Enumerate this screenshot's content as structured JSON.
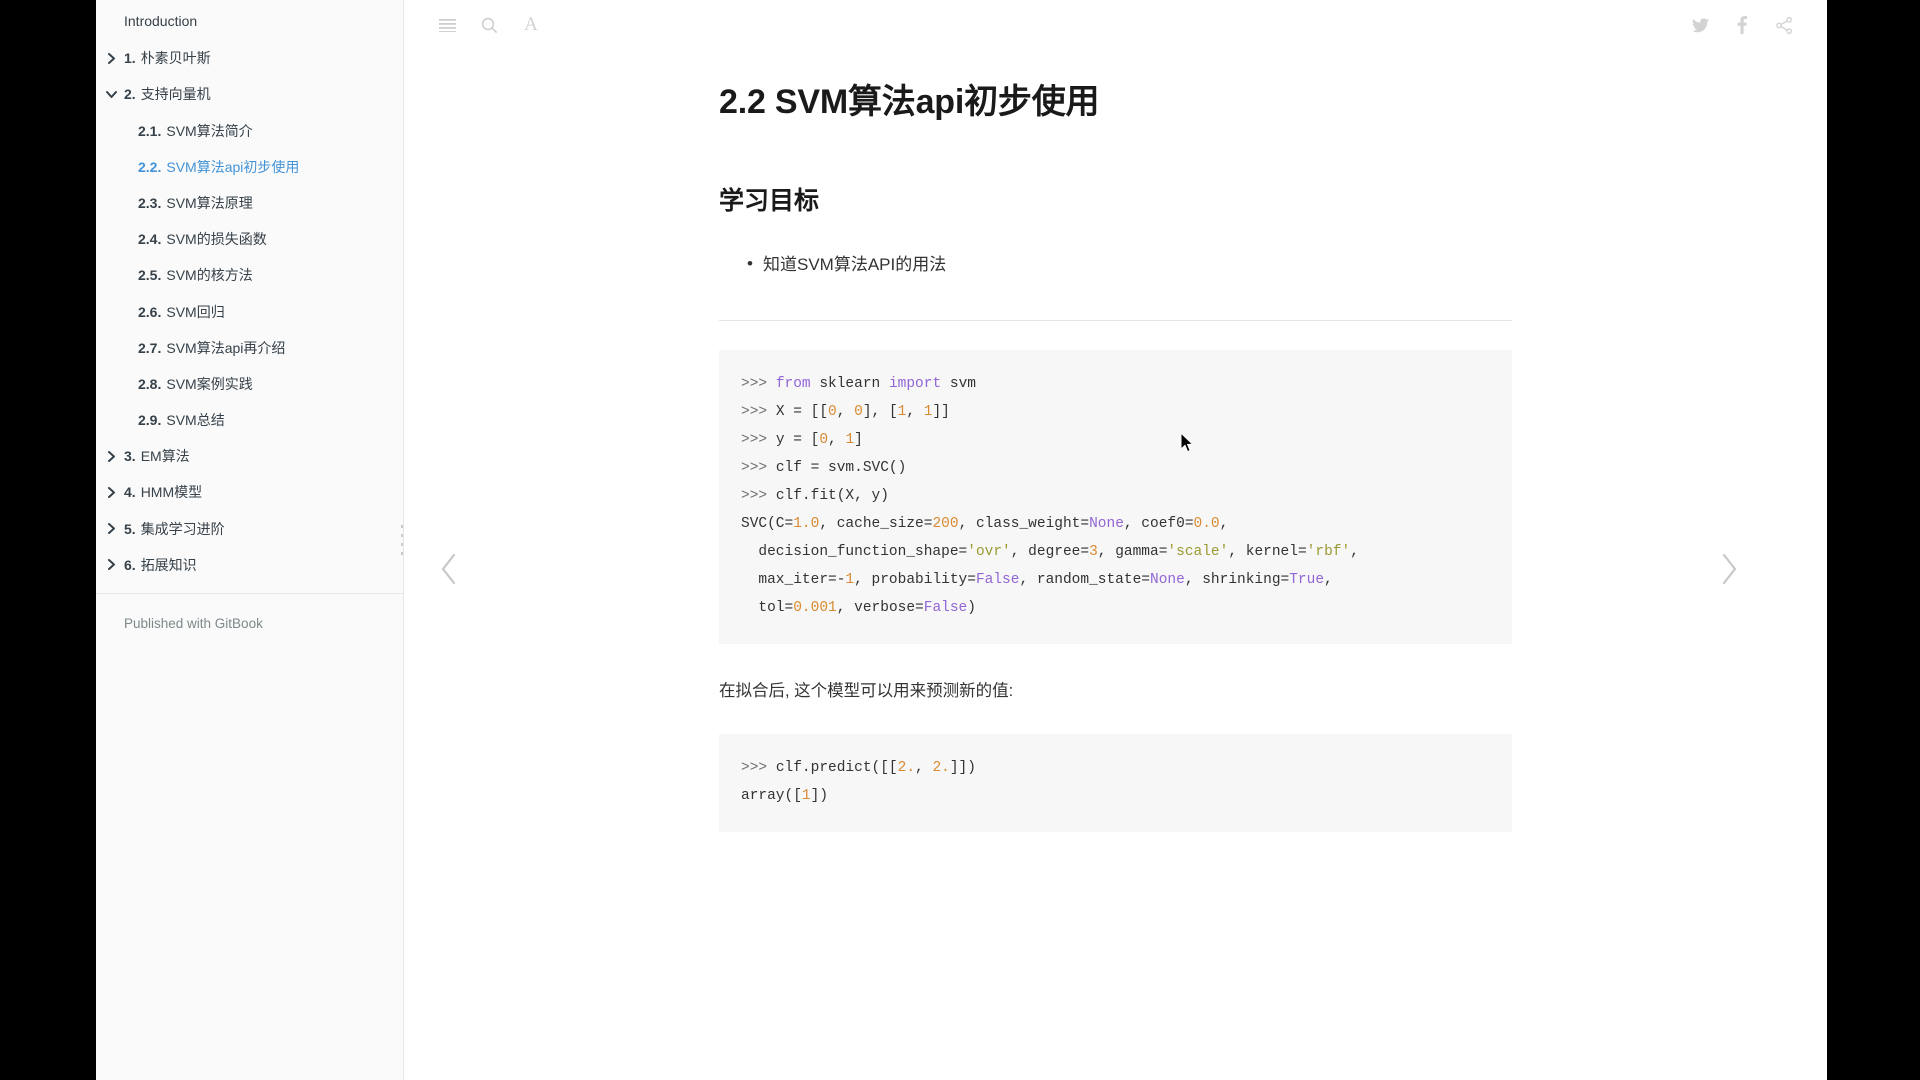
{
  "sidebar": {
    "intro_label": "Introduction",
    "footer_label": "Published with GitBook",
    "items": [
      {
        "num": "1.",
        "label": "朴素贝叶斯",
        "caret": "chevron-right",
        "level": 1,
        "active": false
      },
      {
        "num": "2.",
        "label": "支持向量机",
        "caret": "chevron-down",
        "level": 1,
        "active": false
      },
      {
        "num": "2.1.",
        "label": "SVM算法简介",
        "caret": "",
        "level": 2,
        "active": false
      },
      {
        "num": "2.2.",
        "label": "SVM算法api初步使用",
        "caret": "",
        "level": 2,
        "active": true
      },
      {
        "num": "2.3.",
        "label": "SVM算法原理",
        "caret": "",
        "level": 2,
        "active": false
      },
      {
        "num": "2.4.",
        "label": "SVM的损失函数",
        "caret": "",
        "level": 2,
        "active": false
      },
      {
        "num": "2.5.",
        "label": "SVM的核方法",
        "caret": "",
        "level": 2,
        "active": false
      },
      {
        "num": "2.6.",
        "label": "SVM回归",
        "caret": "",
        "level": 2,
        "active": false
      },
      {
        "num": "2.7.",
        "label": "SVM算法api再介绍",
        "caret": "",
        "level": 2,
        "active": false
      },
      {
        "num": "2.8.",
        "label": "SVM案例实践",
        "caret": "",
        "level": 2,
        "active": false
      },
      {
        "num": "2.9.",
        "label": "SVM总结",
        "caret": "",
        "level": 2,
        "active": false
      },
      {
        "num": "3.",
        "label": "EM算法",
        "caret": "chevron-right",
        "level": 1,
        "active": false
      },
      {
        "num": "4.",
        "label": "HMM模型",
        "caret": "chevron-right",
        "level": 1,
        "active": false
      },
      {
        "num": "5.",
        "label": "集成学习进阶",
        "caret": "chevron-right",
        "level": 1,
        "active": false
      },
      {
        "num": "6.",
        "label": "拓展知识",
        "caret": "chevron-right",
        "level": 1,
        "active": false
      }
    ]
  },
  "header": {
    "toggle_icon": "hamburger-menu-icon",
    "search_icon": "search-icon",
    "font_icon": "font-size-icon",
    "font_label": "A",
    "twitter_icon": "twitter-icon",
    "facebook_icon": "facebook-icon",
    "share_icon": "share-icon"
  },
  "navigation": {
    "prev_icon": "chevron-left-icon",
    "next_icon": "chevron-right-icon"
  },
  "main": {
    "title": "2.2 SVM算法api初步使用",
    "section_title": "学习目标",
    "goals": [
      "知道SVM算法API的用法"
    ],
    "paragraph": "在拟合后, 这个模型可以用来预测新的值:",
    "code_block_1": [
      {
        "parts": [
          {
            "t": ">>> ",
            "c": "prompt"
          },
          {
            "t": "from ",
            "c": "kw"
          },
          {
            "t": "sklearn ",
            "c": ""
          },
          {
            "t": "import ",
            "c": "kw"
          },
          {
            "t": "svm",
            "c": ""
          }
        ]
      },
      {
        "parts": [
          {
            "t": ">>> ",
            "c": "prompt"
          },
          {
            "t": "X = [[",
            "c": ""
          },
          {
            "t": "0",
            "c": "num"
          },
          {
            "t": ", ",
            "c": ""
          },
          {
            "t": "0",
            "c": "num"
          },
          {
            "t": "], [",
            "c": ""
          },
          {
            "t": "1",
            "c": "num"
          },
          {
            "t": ", ",
            "c": ""
          },
          {
            "t": "1",
            "c": "num"
          },
          {
            "t": "]]",
            "c": ""
          }
        ]
      },
      {
        "parts": [
          {
            "t": ">>> ",
            "c": "prompt"
          },
          {
            "t": "y = [",
            "c": ""
          },
          {
            "t": "0",
            "c": "num"
          },
          {
            "t": ", ",
            "c": ""
          },
          {
            "t": "1",
            "c": "num"
          },
          {
            "t": "]",
            "c": ""
          }
        ]
      },
      {
        "parts": [
          {
            "t": ">>> ",
            "c": "prompt"
          },
          {
            "t": "clf = svm.SVC()",
            "c": ""
          }
        ]
      },
      {
        "parts": [
          {
            "t": ">>> ",
            "c": "prompt"
          },
          {
            "t": "clf.fit(X, y)",
            "c": ""
          }
        ]
      },
      {
        "parts": [
          {
            "t": "SVC(C=",
            "c": ""
          },
          {
            "t": "1.0",
            "c": "num"
          },
          {
            "t": ", cache_size=",
            "c": ""
          },
          {
            "t": "200",
            "c": "num"
          },
          {
            "t": ", class_weight=",
            "c": ""
          },
          {
            "t": "None",
            "c": "const"
          },
          {
            "t": ", coef0=",
            "c": ""
          },
          {
            "t": "0.0",
            "c": "num"
          },
          {
            "t": ",",
            "c": ""
          }
        ]
      },
      {
        "parts": [
          {
            "t": "  decision_function_shape=",
            "c": ""
          },
          {
            "t": "'ovr'",
            "c": "str"
          },
          {
            "t": ", degree=",
            "c": ""
          },
          {
            "t": "3",
            "c": "num"
          },
          {
            "t": ", gamma=",
            "c": ""
          },
          {
            "t": "'scale'",
            "c": "str"
          },
          {
            "t": ", kernel=",
            "c": ""
          },
          {
            "t": "'rbf'",
            "c": "str"
          },
          {
            "t": ",",
            "c": ""
          }
        ]
      },
      {
        "parts": [
          {
            "t": "  max_iter=-",
            "c": ""
          },
          {
            "t": "1",
            "c": "num"
          },
          {
            "t": ", probability=",
            "c": ""
          },
          {
            "t": "False",
            "c": "const"
          },
          {
            "t": ", random_state=",
            "c": ""
          },
          {
            "t": "None",
            "c": "const"
          },
          {
            "t": ", shrinking=",
            "c": ""
          },
          {
            "t": "True",
            "c": "const"
          },
          {
            "t": ",",
            "c": ""
          }
        ]
      },
      {
        "parts": [
          {
            "t": "  tol=",
            "c": ""
          },
          {
            "t": "0.001",
            "c": "num"
          },
          {
            "t": ", verbose=",
            "c": ""
          },
          {
            "t": "False",
            "c": "const"
          },
          {
            "t": ")",
            "c": ""
          }
        ]
      }
    ],
    "code_block_2": [
      {
        "parts": [
          {
            "t": ">>> ",
            "c": "prompt"
          },
          {
            "t": "clf.predict([[",
            "c": ""
          },
          {
            "t": "2.",
            "c": "num"
          },
          {
            "t": ", ",
            "c": ""
          },
          {
            "t": "2.",
            "c": "num"
          },
          {
            "t": "]])",
            "c": ""
          }
        ]
      },
      {
        "parts": [
          {
            "t": "array([",
            "c": ""
          },
          {
            "t": "1",
            "c": "num"
          },
          {
            "t": "])",
            "c": ""
          }
        ]
      }
    ]
  },
  "colors": {
    "accent": "#4393d8",
    "sidebar_bg": "#fafafa",
    "code_bg": "#f7f7f7",
    "text": "#333333",
    "muted": "#7e888b",
    "number": "#d98b34",
    "keyword": "#9266d6",
    "string": "#9a9a33"
  }
}
